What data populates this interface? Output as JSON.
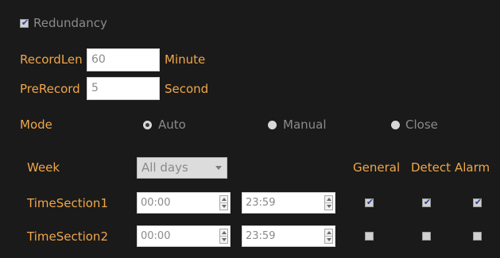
{
  "redundancy": {
    "label": "Redundancy",
    "checked": true
  },
  "record_len": {
    "label": "RecordLen",
    "value": "60",
    "unit": "Minute"
  },
  "pre_record": {
    "label": "PreRecord",
    "value": "5",
    "unit": "Second"
  },
  "mode": {
    "label": "Mode",
    "options": [
      {
        "label": "Auto",
        "selected": true
      },
      {
        "label": "Manual",
        "selected": false
      },
      {
        "label": "Close",
        "selected": false
      }
    ]
  },
  "week": {
    "label": "Week",
    "selected": "All days"
  },
  "columns": {
    "general": "General",
    "detect": "Detect",
    "alarm": "Alarm"
  },
  "time_sections": [
    {
      "label": "TimeSection1",
      "start": "00:00",
      "end": "23:59",
      "general": true,
      "detect": true,
      "alarm": true
    },
    {
      "label": "TimeSection2",
      "start": "00:00",
      "end": "23:59",
      "general": false,
      "detect": false,
      "alarm": false
    }
  ],
  "colors": {
    "background": "#1a1a1a",
    "label": "#f0a64a",
    "muted_text": "#8a8a8a"
  }
}
